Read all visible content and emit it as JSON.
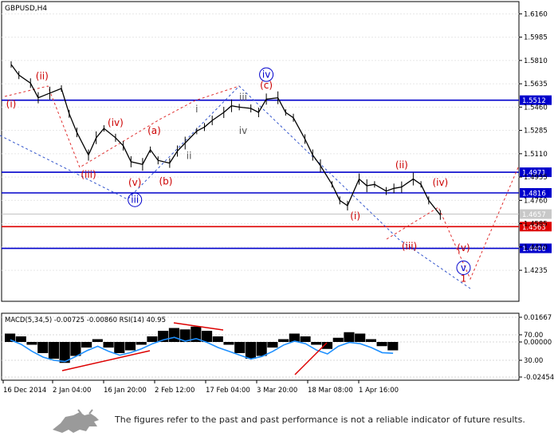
{
  "chart_data": [
    {
      "type": "line",
      "title": "GBPUSD,H4",
      "symbol": "GBPUSD",
      "timeframe": "H4",
      "ylim": [
        1.4098,
        1.6198
      ],
      "y_ticks": [
        "1.6160",
        "1.5985",
        "1.5810",
        "1.5635",
        "1.5460",
        "1.5285",
        "1.5110",
        "1.4935",
        "1.4760",
        "1.4585",
        "1.4410",
        "1.4235"
      ],
      "x_ticks": [
        "16 Dec 2014",
        "2 Jan 04:00",
        "16 Jan 20:00",
        "2 Feb 12:00",
        "17 Feb 04:00",
        "3 Mar 20:00",
        "18 Mar 08:00",
        "1 Apr 16:00"
      ],
      "grid": true,
      "colors": {
        "price": "#000000",
        "support": "#0000cc",
        "current": "#dd0000",
        "wave": "#cc0000",
        "projection": "#e03030",
        "channel": "#3355cc",
        "bid": "#c0c0c0"
      },
      "levels": [
        {
          "value": 1.5512,
          "label": "1.5512",
          "kind": "resistance"
        },
        {
          "value": 1.4971,
          "label": "1.4971",
          "kind": "resistance"
        },
        {
          "value": 1.4816,
          "label": "1.4816",
          "kind": "resistance"
        },
        {
          "value": 1.4657,
          "label": "1.4657",
          "kind": "bid"
        },
        {
          "value": 1.4563,
          "label": "1.4563",
          "kind": "current"
        },
        {
          "value": 1.44,
          "label": "1.4400",
          "kind": "support"
        }
      ],
      "series": [
        {
          "x": [
            "16 Dec",
            "18 Dec",
            "21 Dec",
            "23 Dec",
            "26 Dec",
            "29 Dec",
            "31 Dec",
            "2 Jan",
            "5 Jan",
            "7 Jan",
            "9 Jan",
            "12 Jan",
            "14 Jan",
            "16 Jan",
            "19 Jan",
            "21 Jan",
            "23 Jan",
            "26 Jan",
            "28 Jan",
            "30 Jan",
            "2 Feb",
            "4 Feb",
            "6 Feb",
            "9 Feb",
            "11 Feb",
            "13 Feb",
            "16 Feb",
            "18 Feb",
            "20 Feb",
            "23 Feb",
            "25 Feb",
            "27 Feb",
            "2 Mar",
            "4 Mar",
            "6 Mar",
            "9 Mar",
            "11 Mar",
            "13 Mar",
            "16 Mar",
            "18 Mar",
            "20 Mar",
            "23 Mar",
            "25 Mar",
            "27 Mar",
            "30 Mar",
            "1 Apr",
            "3 Apr",
            "6 Apr"
          ],
          "close": [
            1.578,
            1.57,
            1.564,
            1.553,
            1.5565,
            1.56,
            1.541,
            1.527,
            1.51,
            1.523,
            1.53,
            1.523,
            1.517,
            1.505,
            1.503,
            1.514,
            1.506,
            1.504,
            1.513,
            1.519,
            1.528,
            1.531,
            1.536,
            1.542,
            1.547,
            1.546,
            1.545,
            1.542,
            1.552,
            1.553,
            1.542,
            1.538,
            1.522,
            1.51,
            1.502,
            1.488,
            1.476,
            1.472,
            1.492,
            1.487,
            1.488,
            1.483,
            1.485,
            1.486,
            1.492,
            1.488,
            1.476,
            1.465
          ]
        }
      ],
      "wave_labels": [
        {
          "text": "(i)",
          "x": "16 Dec",
          "y": 1.546,
          "color": "#cc0000"
        },
        {
          "text": "(ii)",
          "x": "24 Dec",
          "y": 1.567,
          "color": "#cc0000"
        },
        {
          "text": "(iii)",
          "x": "5 Jan",
          "y": 1.493,
          "color": "#cc0000"
        },
        {
          "text": "(iv)",
          "x": "12 Jan",
          "y": 1.532,
          "color": "#cc0000"
        },
        {
          "text": "(v)",
          "x": "17 Jan",
          "y": 1.487,
          "color": "#cc0000"
        },
        {
          "text": "(a)",
          "x": "22 Jan",
          "y": 1.526,
          "color": "#cc0000"
        },
        {
          "text": "(b)",
          "x": "25 Jan",
          "y": 1.488,
          "color": "#cc0000"
        },
        {
          "text": "(c)",
          "x": "20 Feb",
          "y": 1.56,
          "color": "#cc0000"
        },
        {
          "text": "(i)",
          "x": "15 Mar",
          "y": 1.462,
          "color": "#cc0000"
        },
        {
          "text": "(ii)",
          "x": "27 Mar",
          "y": 1.5,
          "color": "#cc0000"
        },
        {
          "text": "(iii)",
          "x": "29 Mar",
          "y": 1.439,
          "color": "#cc0000"
        },
        {
          "text": "(iv)",
          "x": "6 Apr",
          "y": 1.487,
          "color": "#cc0000"
        },
        {
          "text": "(v)",
          "x": "12 Apr",
          "y": 1.438,
          "color": "#cc0000"
        },
        {
          "text": "1",
          "x": "12 Apr",
          "y": 1.415,
          "color": "#cc0000"
        },
        {
          "text": "i",
          "x": "2 Feb",
          "y": 1.542,
          "color": "#555555"
        },
        {
          "text": "ii",
          "x": "31 Jan",
          "y": 1.507,
          "color": "#555555"
        },
        {
          "text": "iii",
          "x": "14 Feb",
          "y": 1.551,
          "color": "#555555"
        },
        {
          "text": "iv",
          "x": "14 Feb",
          "y": 1.526,
          "color": "#555555"
        },
        {
          "text": "iii",
          "x": "17 Jan",
          "y": 1.474,
          "color": "#0000cc",
          "circled": true
        },
        {
          "text": "iv",
          "x": "20 Feb",
          "y": 1.568,
          "color": "#0000cc",
          "circled": true
        },
        {
          "text": "v",
          "x": "12 Apr",
          "y": 1.423,
          "color": "#0000cc",
          "circled": true
        }
      ]
    },
    {
      "type": "bar",
      "title": "MACD(5,34,5) -0.00725 -0.00860 RSI(14) 40.95",
      "indicator_text": "MACD(5,34,5) -0.00725 -0.00860 RSI(14) 40.95",
      "y_ticks": [
        "0.01667",
        "70.00",
        "0.00000",
        "30.00",
        "-0.02454"
      ],
      "ylim": [
        -0.02454,
        0.01667
      ],
      "rsi_levels": [
        70,
        30
      ],
      "colors": {
        "histogram": "#000000",
        "rsi": "#1e90ff",
        "trend": "#dd0000"
      },
      "series": [
        {
          "name": "MACD",
          "values": [
            0.006,
            0.004,
            -0.002,
            -0.008,
            -0.012,
            -0.015,
            -0.01,
            -0.004,
            0.002,
            -0.004,
            -0.008,
            -0.006,
            -0.002,
            0.004,
            0.008,
            0.01,
            0.009,
            0.011,
            0.008,
            0.004,
            -0.002,
            -0.008,
            -0.012,
            -0.01,
            -0.004,
            0.002,
            0.006,
            0.004,
            -0.002,
            -0.005,
            0.003,
            0.007,
            0.006,
            0.002,
            -0.003,
            -0.006
          ]
        },
        {
          "name": "RSI",
          "values": [
            62,
            55,
            44,
            35,
            30,
            28,
            36,
            45,
            52,
            44,
            38,
            42,
            48,
            56,
            62,
            66,
            60,
            64,
            58,
            50,
            44,
            38,
            32,
            36,
            44,
            54,
            60,
            56,
            46,
            40,
            52,
            58,
            56,
            50,
            42,
            40.95
          ]
        }
      ]
    }
  ],
  "footer": {
    "disclaimer": "The figures refer to the past and past performance is not a reliable indicator of future results."
  }
}
